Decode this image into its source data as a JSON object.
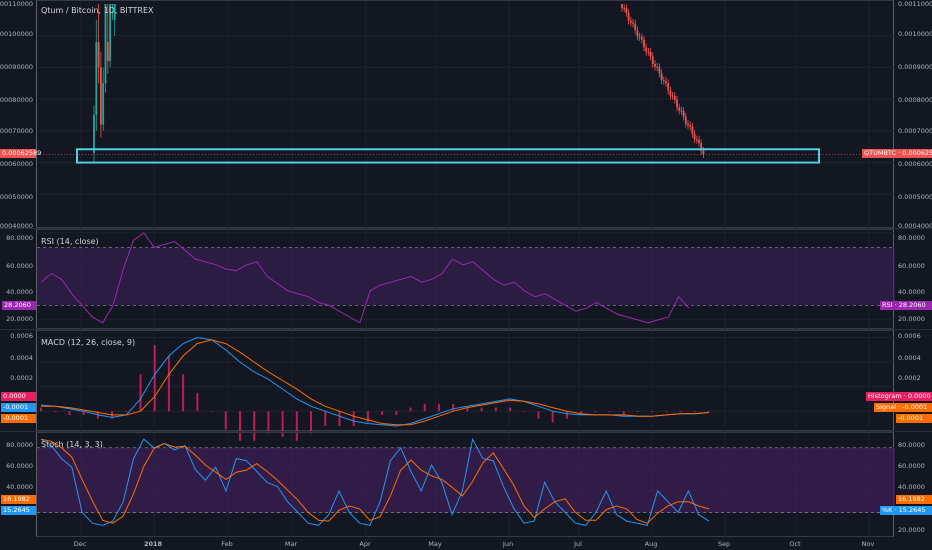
{
  "colors": {
    "background": "#131722",
    "up": "#26a69a",
    "down": "#ef5350",
    "highlight_box": "#4dd0e1",
    "rsi_line": "#9c27b0",
    "rsi_band": "#3c1f56",
    "macd_line": "#2196f3",
    "signal_line": "#ff6d00",
    "histogram": "#e91e63",
    "stoch_k": "#2196f3",
    "stoch_d": "#ff6d00",
    "stoch_band": "#3c1f56"
  },
  "main": {
    "title": "Qtum / Bitcoin, 1D, BITTREX",
    "price_ticks": [
      "0.00110000",
      "0.00100000",
      "0.00090000",
      "0.00080000",
      "0.00070000",
      "0.00060000",
      "0.00050000",
      "0.00040000"
    ],
    "right_ticks": [
      "0.00110000",
      "0.00100000",
      "0.00090000",
      "0.00080000",
      "0.00070000",
      "0.00060000",
      "0.00050000",
      "0.00040000"
    ],
    "last_price_left": "0.00062589",
    "last_price_right": "QTUMBTC · 0.00062589"
  },
  "rsi": {
    "title": "RSI (14, close)",
    "ticks": [
      "80.0000",
      "60.0000",
      "40.0000",
      "20.0000"
    ],
    "right_ticks": [
      "80.0000",
      "60.0000",
      "40.0000",
      "20.0000"
    ],
    "value_left": "28.2060",
    "value_right": "RSI · 28.2060",
    "upper_band": 70,
    "lower_band": 30,
    "ylim": [
      13,
      82
    ]
  },
  "macd": {
    "title": "MACD (12, 26, close, 9)",
    "ticks": [
      "0.0006",
      "0.0004",
      "0.0002",
      "0.0000",
      "-0.0001",
      "-0.0001"
    ],
    "right_ticks": [
      "0.0006",
      "0.0004",
      "0.0002"
    ],
    "histogram_tag": "Histogram · 0.0000",
    "signal_tag": "Signal · -0.0001",
    "macd_tag": "-0.0001"
  },
  "stoch": {
    "title": "Stoch (14, 3, 3)",
    "ticks": [
      "80.0000",
      "60.0000",
      "40.0000",
      "16.1982",
      "15.2645"
    ],
    "right_ticks": [
      "80.0000",
      "60.0000",
      "40.0000",
      "20.0000"
    ],
    "tag_d": "16.1982",
    "tag_k": "%K · 15.2645",
    "upper_band": 80,
    "lower_band": 20,
    "ylim": [
      0,
      90
    ]
  },
  "time_axis": [
    "Dec",
    "2018",
    "Feb",
    "Mar",
    "Apr",
    "May",
    "Jun",
    "Jul",
    "Aug",
    "Sep",
    "Oct",
    "Nov"
  ],
  "chart_data": {
    "type": "line",
    "title": "Qtum / Bitcoin, 1D, BITTREX",
    "x_domain": [
      "Nov 2017",
      "Nov 2018"
    ],
    "price": {
      "ylim": [
        0.0004,
        0.0011
      ],
      "last": 0.00062589,
      "segments": [
        {
          "from": "early Dec 2017",
          "to": "mid Dec 2017",
          "ohlc_hint": "0.00062 rising to >0.0011"
        },
        {
          "from": "late Jul 2018",
          "to": "late Aug 2018",
          "ohlc_hint": "0.0011 falling to 0.000626"
        }
      ]
    },
    "rsi": {
      "ylim": [
        13,
        82
      ],
      "bands": [
        30,
        70
      ],
      "values": [
        46,
        52,
        48,
        38,
        30,
        22,
        18,
        30,
        55,
        75,
        80,
        70,
        72,
        74,
        68,
        62,
        60,
        58,
        55,
        54,
        58,
        60,
        50,
        45,
        40,
        38,
        36,
        32,
        30,
        26,
        22,
        18,
        40,
        44,
        46,
        48,
        50,
        46,
        48,
        52,
        62,
        58,
        60,
        54,
        48,
        44,
        46,
        40,
        36,
        38,
        34,
        30,
        26,
        28,
        32,
        28,
        24,
        22,
        20,
        18,
        20,
        22,
        36,
        28
      ]
    },
    "macd": {
      "macd": [
        5e-05,
        4e-05,
        2e-05,
        0.0,
        -3e-05,
        -5e-05,
        -3e-05,
        0.0001,
        0.0003,
        0.00045,
        0.00055,
        0.0006,
        0.00058,
        0.0005,
        0.0004,
        0.00032,
        0.00026,
        0.00018,
        0.0001,
        4e-05,
        0.0,
        -4e-05,
        -8e-05,
        -0.0001,
        -0.00011,
        -0.00012,
        -0.0001,
        -6e-05,
        -2e-05,
        2e-05,
        4e-05,
        6e-05,
        8e-05,
        0.0001,
        8e-05,
        4e-05,
        0.0,
        -2e-05,
        -3e-05,
        -3e-05,
        -3e-05,
        -4e-05,
        -4e-05,
        -4e-05,
        -3e-05,
        -2e-05,
        -2e-05,
        -1e-05
      ],
      "signal": [
        4e-05,
        4e-05,
        3e-05,
        1e-05,
        -1e-05,
        -3e-05,
        -3e-05,
        0.0,
        0.00012,
        0.0003,
        0.00045,
        0.00055,
        0.00058,
        0.00055,
        0.00048,
        0.0004,
        0.00032,
        0.00025,
        0.00018,
        0.0001,
        4e-05,
        0.0,
        -4e-05,
        -7e-05,
        -0.0001,
        -0.00011,
        -0.00011,
        -8e-05,
        -4e-05,
        0.0,
        3e-05,
        5e-05,
        7e-05,
        9e-05,
        8e-05,
        6e-05,
        3e-05,
        0.0,
        -2e-05,
        -3e-05,
        -3e-05,
        -3e-05,
        -4e-05,
        -4e-05,
        -3e-05,
        -2e-05,
        -2e-05,
        -1e-05
      ],
      "ylim": [
        -0.00012,
        0.00062
      ]
    },
    "stoch": {
      "ylim": [
        0,
        90
      ],
      "bands": [
        20,
        80
      ],
      "k": [
        88,
        82,
        70,
        62,
        20,
        10,
        8,
        12,
        30,
        70,
        88,
        80,
        84,
        78,
        82,
        60,
        50,
        62,
        40,
        70,
        68,
        58,
        48,
        44,
        30,
        20,
        10,
        8,
        18,
        40,
        20,
        10,
        8,
        30,
        68,
        80,
        58,
        40,
        64,
        48,
        18,
        40,
        88,
        70,
        68,
        44,
        24,
        10,
        12,
        48,
        30,
        20,
        10,
        8,
        20,
        40,
        18,
        12,
        10,
        8,
        40,
        30,
        20,
        40,
        18,
        12
      ]
    }
  }
}
